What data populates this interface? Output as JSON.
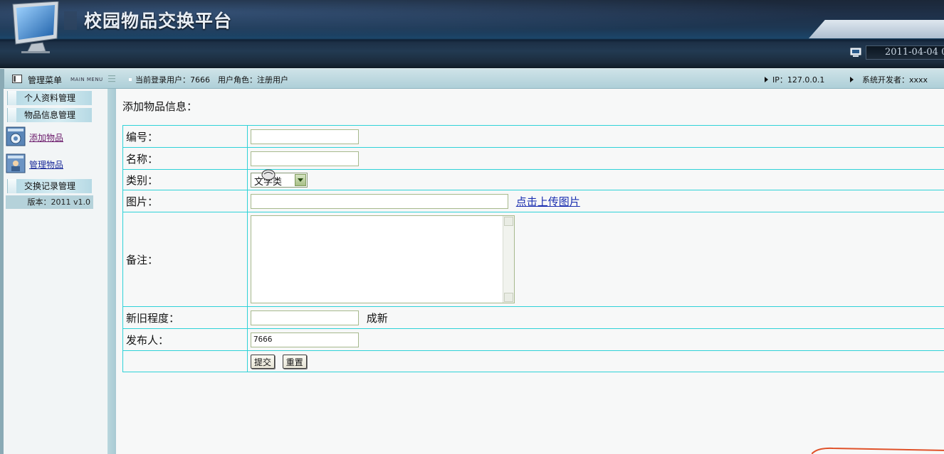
{
  "header": {
    "title": "校园物品交换平台",
    "datetime": "2011-04-04 0"
  },
  "infobar": {
    "menu_title": "管理菜单",
    "menu_sub": "MAIN MENU",
    "user_info": "当前登录用户：7666　用户角色：注册用户",
    "ip": "IP：127.0.0.1",
    "developer": "系统开发者：xxxx"
  },
  "sidebar": {
    "sections": [
      {
        "label": "个人资料管理"
      },
      {
        "label": "物品信息管理"
      },
      {
        "label": "交换记录管理"
      }
    ],
    "items": [
      {
        "label": "添加物品",
        "icon": "gear-window-icon"
      },
      {
        "label": "管理物品",
        "icon": "user-card-icon"
      }
    ],
    "version": "版本：2011 v1.0"
  },
  "form": {
    "heading": "添加物品信息：",
    "fields": {
      "id_label": "编号：",
      "id_value": "",
      "name_label": "名称：",
      "name_value": "",
      "category_label": "类别：",
      "category_value": "文学类",
      "image_label": "图片：",
      "image_value": "",
      "upload_link": "点击上传图片",
      "remark_label": "备注：",
      "remark_value": "",
      "condition_label": "新旧程度：",
      "condition_value": "",
      "condition_suffix": "成新",
      "publisher_label": "发布人：",
      "publisher_value": "7666"
    },
    "submit_label": "提交",
    "reset_label": "重置"
  },
  "colors": {
    "table_border": "#2fd2d8",
    "header_dark": "#1c2b3d",
    "infobar_bg": "#b8d7df",
    "link": "#1b2fb0"
  }
}
